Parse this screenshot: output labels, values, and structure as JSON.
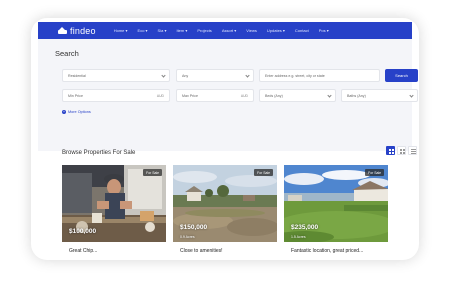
{
  "brand": {
    "logo_text": "findeo",
    "primary_color": "#2741c8"
  },
  "nav": {
    "items": [
      "Home ▾",
      "Eco ▾",
      "Sia ▾",
      "Item ▾",
      "Projects",
      "Assort ▾",
      "Views",
      "Updates ▾",
      "Contact",
      "Pos ▾"
    ]
  },
  "search": {
    "title": "Search",
    "type_select": "Residential",
    "status_select": "Any",
    "location_placeholder": "Enter address e.g. street, city or state",
    "search_button": "Search",
    "min_price_placeholder": "Min Price",
    "max_price_placeholder": "Max Price",
    "price_unit": "AUD",
    "beds_select": "Beds (Any)",
    "baths_select": "Baths (Any)",
    "more_options": "More Options"
  },
  "browse": {
    "title": "Browse Properties For Sale",
    "view_modes": [
      "grid-large",
      "grid-small",
      "list"
    ],
    "cards": [
      {
        "badge": "For Sale",
        "price": "$100,000",
        "acres": "",
        "title": "Great Chip..."
      },
      {
        "badge": "For Sale",
        "price": "$150,000",
        "acres": "0.9 Acres",
        "title": "Close to amenities!"
      },
      {
        "badge": "For Sale",
        "price": "$235,000",
        "acres": "1.5 Acres",
        "title": "Fantastic location, great priced..."
      }
    ]
  }
}
